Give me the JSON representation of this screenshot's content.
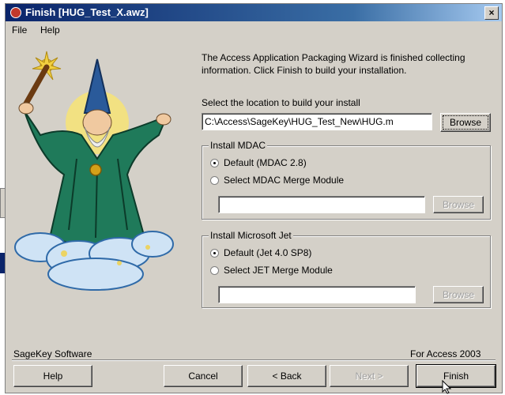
{
  "window": {
    "title": "Finish [HUG_Test_X.awz]",
    "close_glyph": "×"
  },
  "menu": {
    "items": [
      "File",
      "Help"
    ]
  },
  "intro_text": "The Access Application Packaging Wizard is finished collecting information. Click Finish to build your installation.",
  "location": {
    "label": "Select the location to build your install",
    "value": "C:\\Access\\SageKey\\HUG_Test_New\\HUG.m",
    "browse_label": "Browse"
  },
  "mdac": {
    "legend": "Install MDAC",
    "option_default": "Default (MDAC 2.8)",
    "option_merge": "Select MDAC Merge Module",
    "module_value": "",
    "browse_label": "Browse"
  },
  "jet": {
    "legend": "Install Microsoft Jet",
    "option_default": "Default (Jet 4.0 SP8)",
    "option_merge": "Select JET Merge Module",
    "module_value": "",
    "browse_label": "Browse"
  },
  "footer": {
    "company": "SageKey Software",
    "product_version": "For Access 2003",
    "help_label": "Help",
    "cancel_label": "Cancel",
    "back_label": "< Back",
    "next_label": "Next >",
    "finish_label": "Finish"
  },
  "colors": {
    "title_start": "#0a246a",
    "title_end": "#a6caf0",
    "dialog_bg": "#d4d0c8",
    "robe": "#1f7a5a",
    "cloud": "#6aa7d8"
  }
}
